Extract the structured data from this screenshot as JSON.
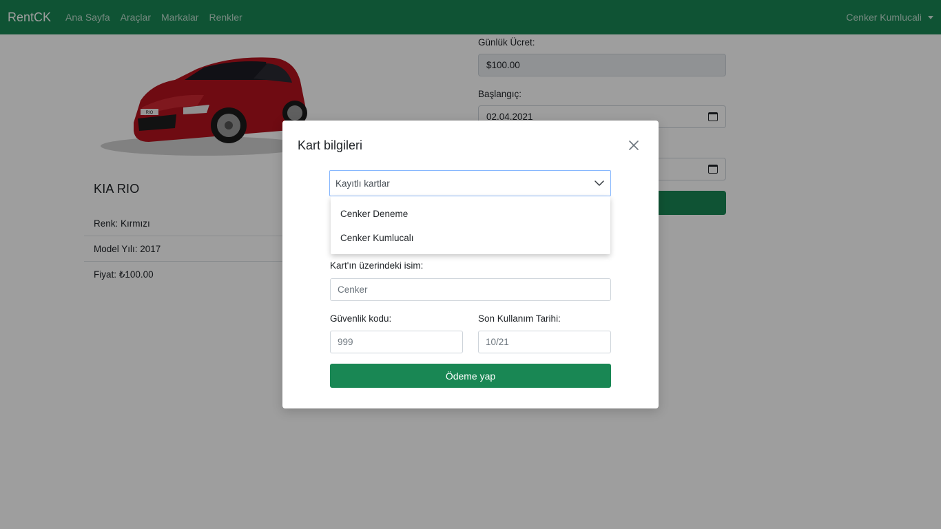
{
  "navbar": {
    "brand": "RentCK",
    "links": [
      "Ana Sayfa",
      "Araçlar",
      "Markalar",
      "Renkler"
    ],
    "user": "Cenker Kumlucali"
  },
  "car": {
    "image_icon": "red-hatchback-car-image",
    "plate_text": "RIO",
    "title": "KIA RIO",
    "details": [
      "Renk: Kırmızı",
      "Model Yılı: 2017",
      "Fiyat: ₺100.00"
    ]
  },
  "rental_form": {
    "daily_fee_label": "Günlük Ücret:",
    "daily_fee_value": "$100.00",
    "start_label": "Başlangıç:",
    "start_value": "02.04.2021"
  },
  "modal": {
    "title": "Kart bilgileri",
    "saved_cards_select": "Kayıtlı kartlar",
    "saved_cards_options": [
      "Cenker Deneme",
      "Cenker Kumlucalı"
    ],
    "card_name_label": "Kart'ın üzerindeki isim:",
    "card_name_value": "Cenker",
    "security_code_label": "Güvenlik kodu:",
    "security_code_value": "999",
    "expiry_label": "Son Kullanım Tarihi:",
    "expiry_value": "10/21",
    "pay_button": "Ödeme yap"
  },
  "colors": {
    "primary": "#198754",
    "focus_border": "#86b7fe"
  }
}
